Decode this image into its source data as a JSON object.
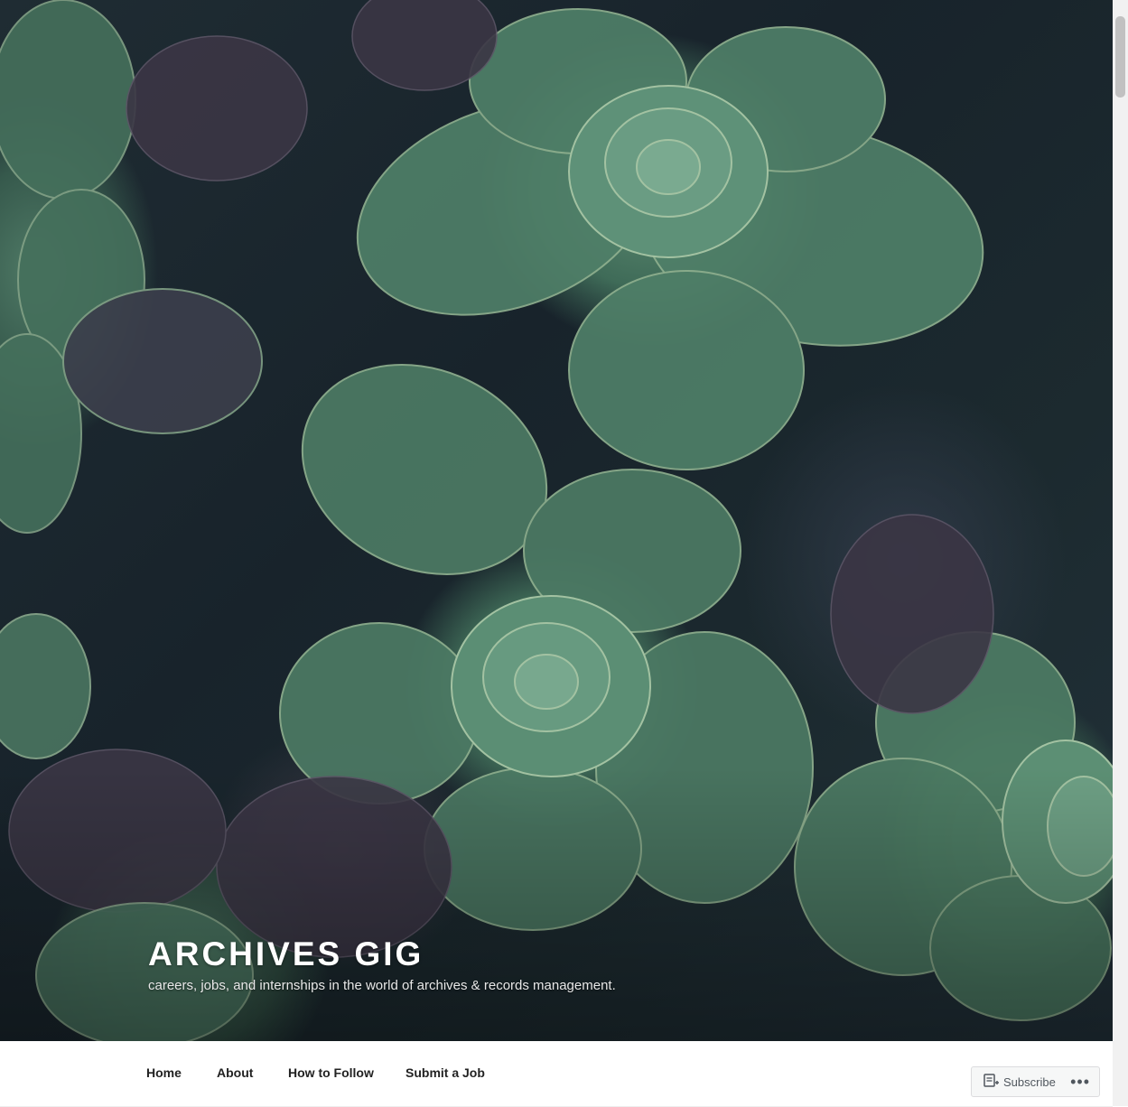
{
  "site": {
    "title": "ARCHIVES GIG",
    "tagline": "careers, jobs, and internships in the world of archives & records management."
  },
  "nav": {
    "items": [
      {
        "label": "Home"
      },
      {
        "label": "About"
      },
      {
        "label": "How to Follow"
      },
      {
        "label": "Submit a Job"
      }
    ]
  },
  "subscribe": {
    "label": "Subscribe",
    "more_label": "•••",
    "icon": "reader-follow-icon"
  },
  "colors": {
    "hero_dark": "#1c2a2f",
    "leaf_green": "#5f8d73",
    "text_dark": "#222222"
  }
}
